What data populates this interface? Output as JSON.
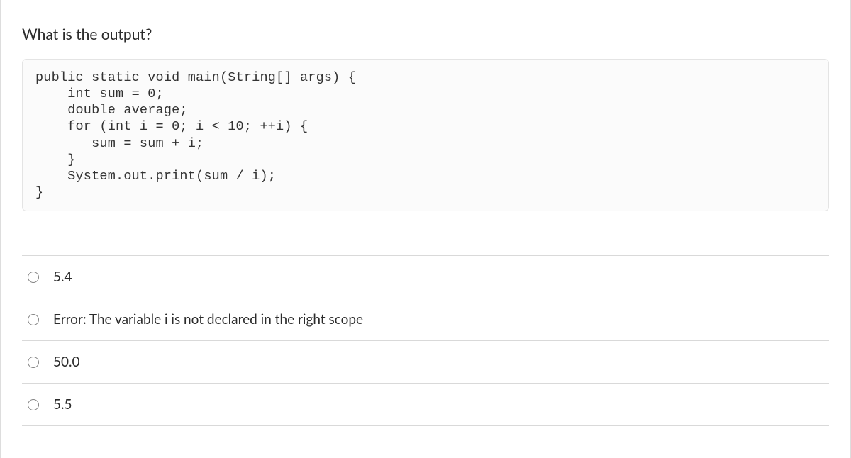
{
  "question": {
    "title": "What is the output?",
    "code": "public static void main(String[] args) {\n    int sum = 0;\n    double average;\n    for (int i = 0; i < 10; ++i) {\n       sum = sum + i;\n    }\n    System.out.print(sum / i);\n}"
  },
  "options": [
    {
      "label": "5.4"
    },
    {
      "label": "Error: The variable i is not declared in the right scope"
    },
    {
      "label": "50.0"
    },
    {
      "label": "5.5"
    }
  ]
}
